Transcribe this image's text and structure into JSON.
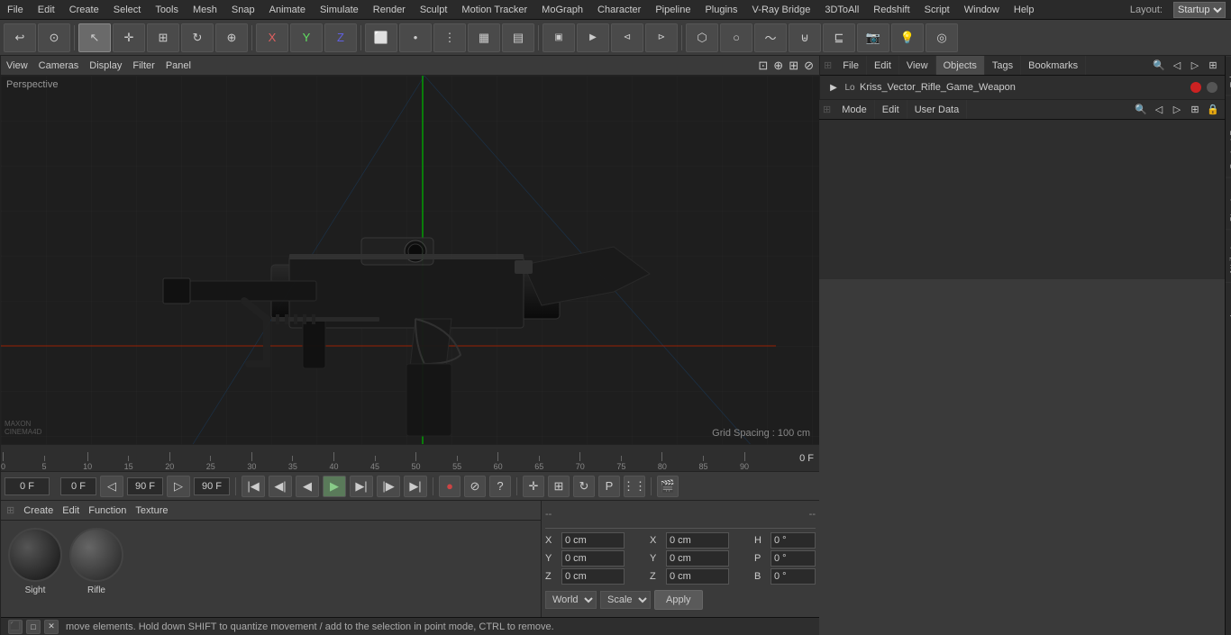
{
  "menu": {
    "items": [
      "File",
      "Edit",
      "Create",
      "Select",
      "Tools",
      "Mesh",
      "Snap",
      "Animate",
      "Simulate",
      "Render",
      "Sculpt",
      "Motion Tracker",
      "MoGraph",
      "Character",
      "Pipeline",
      "Plugins",
      "V-Ray Bridge",
      "3DToAll",
      "Redshift",
      "Script",
      "Window",
      "Help"
    ],
    "layout_label": "Layout:",
    "layout_value": "Startup"
  },
  "toolbar": {
    "undo_icon": "↩",
    "snap_icon": "⊡",
    "select_icon": "↖",
    "move_icon": "✛",
    "scale_icon": "⊞",
    "rotate_icon": "↻",
    "scale2_icon": "⊕",
    "x_icon": "X",
    "y_icon": "Y",
    "z_icon": "Z",
    "cube_icon": "⬜",
    "camera_icon": "📷",
    "render_icon": "▶",
    "render2_icon": "⊲",
    "render3_icon": "⊳",
    "light_icon": "💡"
  },
  "viewport": {
    "label": "Perspective",
    "menu_items": [
      "View",
      "Cameras",
      "Display",
      "Filter",
      "Panel"
    ],
    "grid_spacing": "Grid Spacing : 100 cm"
  },
  "timeline": {
    "ticks": [
      0,
      5,
      10,
      15,
      20,
      25,
      30,
      35,
      40,
      45,
      50,
      55,
      60,
      65,
      70,
      75,
      80,
      85,
      90
    ],
    "frame_indicator": "0 F",
    "current_frame": "0 F",
    "start_frame": "0 F",
    "end_frame": "90 F",
    "end_frame2": "90 F"
  },
  "transport": {
    "frame_start": "0 F",
    "frame_current": "0 F",
    "frame_end": "90 F",
    "frame_total": "90 F"
  },
  "material_editor": {
    "menu_items": [
      "Create",
      "Edit",
      "Function",
      "Texture"
    ],
    "materials": [
      {
        "name": "Sight",
        "color1": "#222222",
        "color2": "#444444"
      },
      {
        "name": "Rifle",
        "color1": "#333333",
        "color2": "#555555"
      }
    ]
  },
  "coordinates": {
    "sep1": "--",
    "sep2": "--",
    "x_pos_label": "X",
    "y_pos_label": "Y",
    "z_pos_label": "Z",
    "x_pos_value": "0 cm",
    "y_pos_value": "0 cm",
    "z_pos_value": "0 cm",
    "x_size_label": "X",
    "y_size_label": "Y",
    "z_size_label": "Z",
    "x_size_value": "0 cm",
    "y_size_value": "0 cm",
    "z_size_value": "0 cm",
    "h_label": "H",
    "p_label": "P",
    "b_label": "B",
    "h_value": "0 °",
    "p_value": "0 °",
    "b_value": "0 °",
    "world_label": "World",
    "scale_label": "Scale",
    "apply_label": "Apply"
  },
  "right_panel": {
    "top_tabs": [
      "File",
      "Edit",
      "View",
      "Objects",
      "Tags",
      "Bookmarks"
    ],
    "object_name": "Kriss_Vector_Rifle_Game_Weapon",
    "dot_color": "#cc2222"
  },
  "attributes": {
    "tabs": [
      "Mode",
      "Edit",
      "User Data"
    ]
  },
  "vertical_tabs": [
    "Takes",
    "Content Browser",
    "Structure",
    "Attributes",
    "Layers"
  ],
  "status_bar": {
    "message": "move elements. Hold down SHIFT to quantize movement / add to the selection in point mode, CTRL to remove."
  }
}
